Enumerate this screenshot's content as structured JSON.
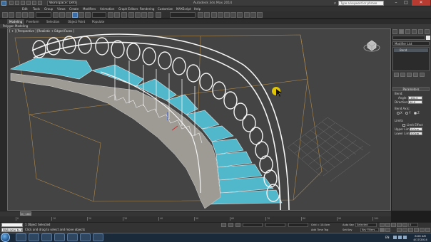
{
  "titlebar": {
    "workspace": "Workspace: Default",
    "window_title": "Autodesk 3ds Max 2014",
    "search_placeholder": "Type a keyword or phrase",
    "minimize": "–",
    "maximize": "□",
    "close": "✕"
  },
  "menu": {
    "items": [
      "Edit",
      "Tools",
      "Group",
      "Views",
      "Create",
      "Modifiers",
      "Animation",
      "Graph Editors",
      "Rendering",
      "Customize",
      "MAXScript",
      "Help"
    ]
  },
  "ribbon": {
    "tabs": [
      "Modeling",
      "Freeform",
      "Selection",
      "Object Paint",
      "Populate"
    ],
    "active_tab": "Modeling",
    "sub_label": "Polygon Modeling"
  },
  "viewport": {
    "label": "[ + ] [Perspective ] [Realistic + Edged Faces ]"
  },
  "command_panel": {
    "modifier_list": "Modifier List",
    "stack_item": "Bend",
    "rollout_parameters": "Parameters",
    "bend_label": "Bend:",
    "angle_label": "Angle:",
    "angle_value": "-162.0",
    "direction_label": "Direction:",
    "direction_value": "90.0",
    "bend_axis_label": "Bend Axis:",
    "axis_x": "X",
    "axis_y": "Y",
    "axis_z": "Z",
    "limits_label": "Limits",
    "limit_effect_label": "Limit Effect",
    "upper_limit_label": "Upper Limit:",
    "upper_limit_value": "0.0cm",
    "lower_limit_label": "Lower Limit:",
    "lower_limit_value": "0.0cm"
  },
  "timeline": {
    "slider_label": "0 / 100",
    "ticks": [
      "0",
      "10",
      "20",
      "30",
      "40",
      "50",
      "60",
      "70",
      "80",
      "90",
      "100"
    ]
  },
  "status": {
    "maxscript_text": "Welcome to M",
    "line1": "1 Object Selected",
    "line2": "Click and drag to select and move objects",
    "grid_text": "Grid = 10.0cm",
    "add_time_tag": "Add Time Tag",
    "auto_key": "Auto Key",
    "selected": "Selected",
    "set_key": "Set Key",
    "key_filters": "Key Filters...",
    "frame_value": "0"
  },
  "taskbar": {
    "language": "EN",
    "time": "8:06 AM",
    "date": "4/17/2014"
  }
}
